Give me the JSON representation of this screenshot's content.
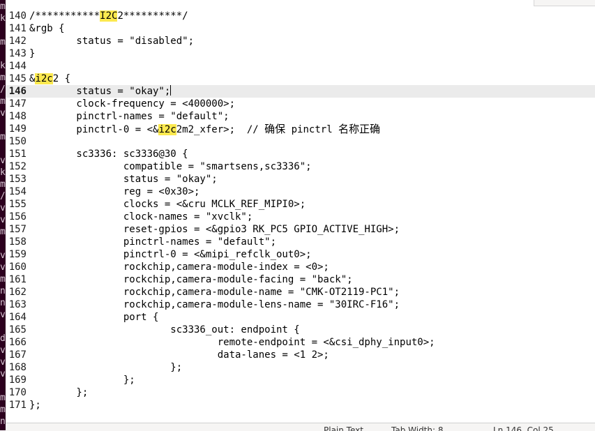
{
  "editor": {
    "current_line": 146,
    "lines": [
      {
        "n": "140",
        "segs": [
          {
            "t": "/***********"
          },
          {
            "t": "I2C",
            "hl": true
          },
          {
            "t": "2**********/"
          }
        ]
      },
      {
        "n": "141",
        "segs": [
          {
            "t": "&rgb {"
          }
        ]
      },
      {
        "n": "142",
        "segs": [
          {
            "t": "        status = \"disabled\";"
          }
        ]
      },
      {
        "n": "143",
        "segs": [
          {
            "t": "}"
          }
        ]
      },
      {
        "n": "144",
        "segs": [
          {
            "t": ""
          }
        ]
      },
      {
        "n": "145",
        "segs": [
          {
            "t": "&"
          },
          {
            "t": "i2c",
            "hl": true
          },
          {
            "t": "2 {"
          }
        ]
      },
      {
        "n": "146",
        "current": true,
        "segs": [
          {
            "t": "        status = \"okay\";"
          }
        ]
      },
      {
        "n": "147",
        "segs": [
          {
            "t": "        clock-frequency = <400000>;"
          }
        ]
      },
      {
        "n": "148",
        "segs": [
          {
            "t": "        pinctrl-names = \"default\";"
          }
        ]
      },
      {
        "n": "149",
        "segs": [
          {
            "t": "        pinctrl-0 = <&"
          },
          {
            "t": "i2c",
            "hl": true
          },
          {
            "t": "2m2_xfer>;  // "
          },
          {
            "t": "确保",
            "cjk": true
          },
          {
            "t": " pinctrl "
          },
          {
            "t": "名称正确",
            "cjk": true
          }
        ]
      },
      {
        "n": "150",
        "segs": [
          {
            "t": ""
          }
        ]
      },
      {
        "n": "151",
        "segs": [
          {
            "t": "        sc3336: sc3336@30 {"
          }
        ]
      },
      {
        "n": "152",
        "segs": [
          {
            "t": "                compatible = \"smartsens,sc3336\";"
          }
        ]
      },
      {
        "n": "153",
        "segs": [
          {
            "t": "                status = \"okay\";"
          }
        ]
      },
      {
        "n": "154",
        "segs": [
          {
            "t": "                reg = <0x30>;"
          }
        ]
      },
      {
        "n": "155",
        "segs": [
          {
            "t": "                clocks = <&cru MCLK_REF_MIPI0>;"
          }
        ]
      },
      {
        "n": "156",
        "segs": [
          {
            "t": "                clock-names = \"xvclk\";"
          }
        ]
      },
      {
        "n": "157",
        "segs": [
          {
            "t": "                reset-gpios = <&gpio3 RK_PC5 GPIO_ACTIVE_HIGH>;"
          }
        ]
      },
      {
        "n": "158",
        "segs": [
          {
            "t": "                pinctrl-names = \"default\";"
          }
        ]
      },
      {
        "n": "159",
        "segs": [
          {
            "t": "                pinctrl-0 = <&mipi_refclk_out0>;"
          }
        ]
      },
      {
        "n": "160",
        "segs": [
          {
            "t": "                rockchip,camera-module-index = <0>;"
          }
        ]
      },
      {
        "n": "161",
        "segs": [
          {
            "t": "                rockchip,camera-module-facing = \"back\";"
          }
        ]
      },
      {
        "n": "162",
        "segs": [
          {
            "t": "                rockchip,camera-module-name = \"CMK-OT2119-PC1\";"
          }
        ]
      },
      {
        "n": "163",
        "segs": [
          {
            "t": "                rockchip,camera-module-lens-name = \"30IRC-F16\";"
          }
        ]
      },
      {
        "n": "164",
        "segs": [
          {
            "t": "                port {"
          }
        ]
      },
      {
        "n": "165",
        "segs": [
          {
            "t": "                        sc3336_out: endpoint {"
          }
        ]
      },
      {
        "n": "166",
        "segs": [
          {
            "t": "                                remote-endpoint = <&csi_dphy_input0>;"
          }
        ]
      },
      {
        "n": "167",
        "segs": [
          {
            "t": "                                data-lanes = <1 2>;"
          }
        ]
      },
      {
        "n": "168",
        "segs": [
          {
            "t": "                        };"
          }
        ]
      },
      {
        "n": "169",
        "segs": [
          {
            "t": "                };"
          }
        ]
      },
      {
        "n": "170",
        "segs": [
          {
            "t": "        };"
          }
        ]
      },
      {
        "n": "171",
        "segs": [
          {
            "t": "};"
          }
        ]
      }
    ]
  },
  "statusbar": {
    "language": "Plain Text",
    "tab_width": "Tab Width: 8",
    "position": "Ln 146, Col 25",
    "dropdown_icon": "chevron-down-icon"
  },
  "left_strip": {
    "chars": [
      "m",
      "k",
      "",
      "m",
      "",
      "k",
      "m",
      "/",
      "m",
      "v",
      "",
      "m",
      "",
      "v",
      "k",
      "m",
      "/",
      "v",
      "v",
      "m",
      "",
      "v",
      "v",
      "m",
      "n",
      "n",
      "v",
      "",
      "d",
      "v",
      "v",
      "v",
      "",
      "m",
      "m",
      "n"
    ]
  },
  "colors": {
    "highlight": "#fce94f",
    "current_line": "#ebebeb",
    "left_strip": "#2c001e"
  }
}
